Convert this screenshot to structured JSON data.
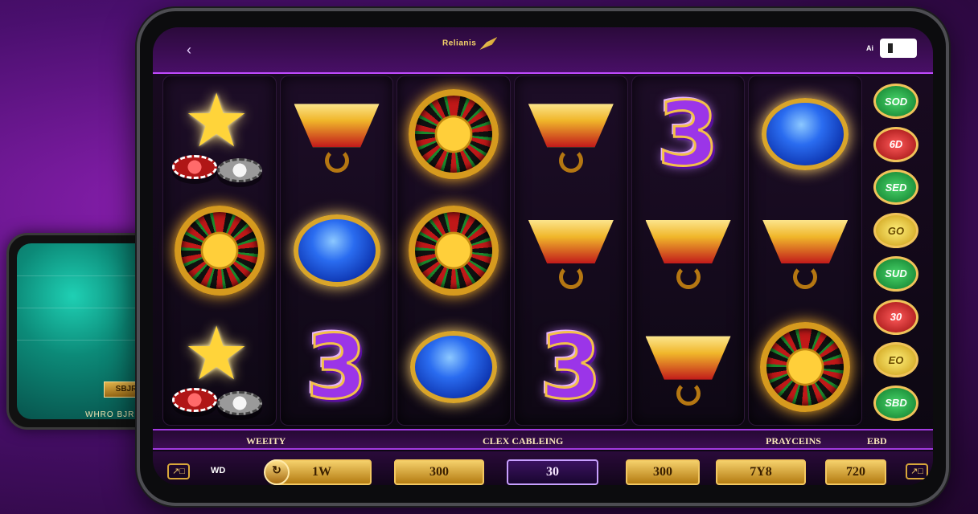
{
  "background_phone": {
    "chip_label": "SBJR",
    "bottom_label": "WHRO BJR"
  },
  "topbar": {
    "back_icon": "chevron-left-icon",
    "logo_text": "Relianis",
    "signal_text": "Ai"
  },
  "reels": [
    [
      "star-chips",
      "roulette",
      "star-chips"
    ],
    [
      "gold-shield",
      "blue-gem",
      "purple-three"
    ],
    [
      "roulette",
      "roulette",
      "blue-gem"
    ],
    [
      "gold-shield",
      "gold-shield",
      "purple-three"
    ],
    [
      "purple-three",
      "gold-shield",
      "gold-shield"
    ],
    [
      "blue-gem",
      "gold-shield",
      "roulette"
    ]
  ],
  "side_buttons": [
    {
      "label": "SOD",
      "color": "green"
    },
    {
      "label": "6D",
      "color": "red"
    },
    {
      "label": "SED",
      "color": "green"
    },
    {
      "label": "GO",
      "color": "gold"
    },
    {
      "label": "SUD",
      "color": "green"
    },
    {
      "label": "30",
      "color": "red"
    },
    {
      "label": "EO",
      "color": "gold"
    },
    {
      "label": "SBD",
      "color": "green"
    }
  ],
  "info_bar": {
    "left": "WEEITY",
    "center": "CLEX CABLEING",
    "right": "PRAYCEINS",
    "far_right": "EBD"
  },
  "controls": {
    "left_icon_text": "↗□",
    "left_label": "WD",
    "bet_1": "1W",
    "bet_2": "300",
    "bet_3": "30",
    "bet_4": "300",
    "bet_5": "7Y8",
    "bet_6": "720",
    "right_icon_text": "↗□"
  },
  "colors": {
    "background": "#4a0f6e",
    "accent_purple": "#c04bff",
    "gold": "#f2c760"
  }
}
